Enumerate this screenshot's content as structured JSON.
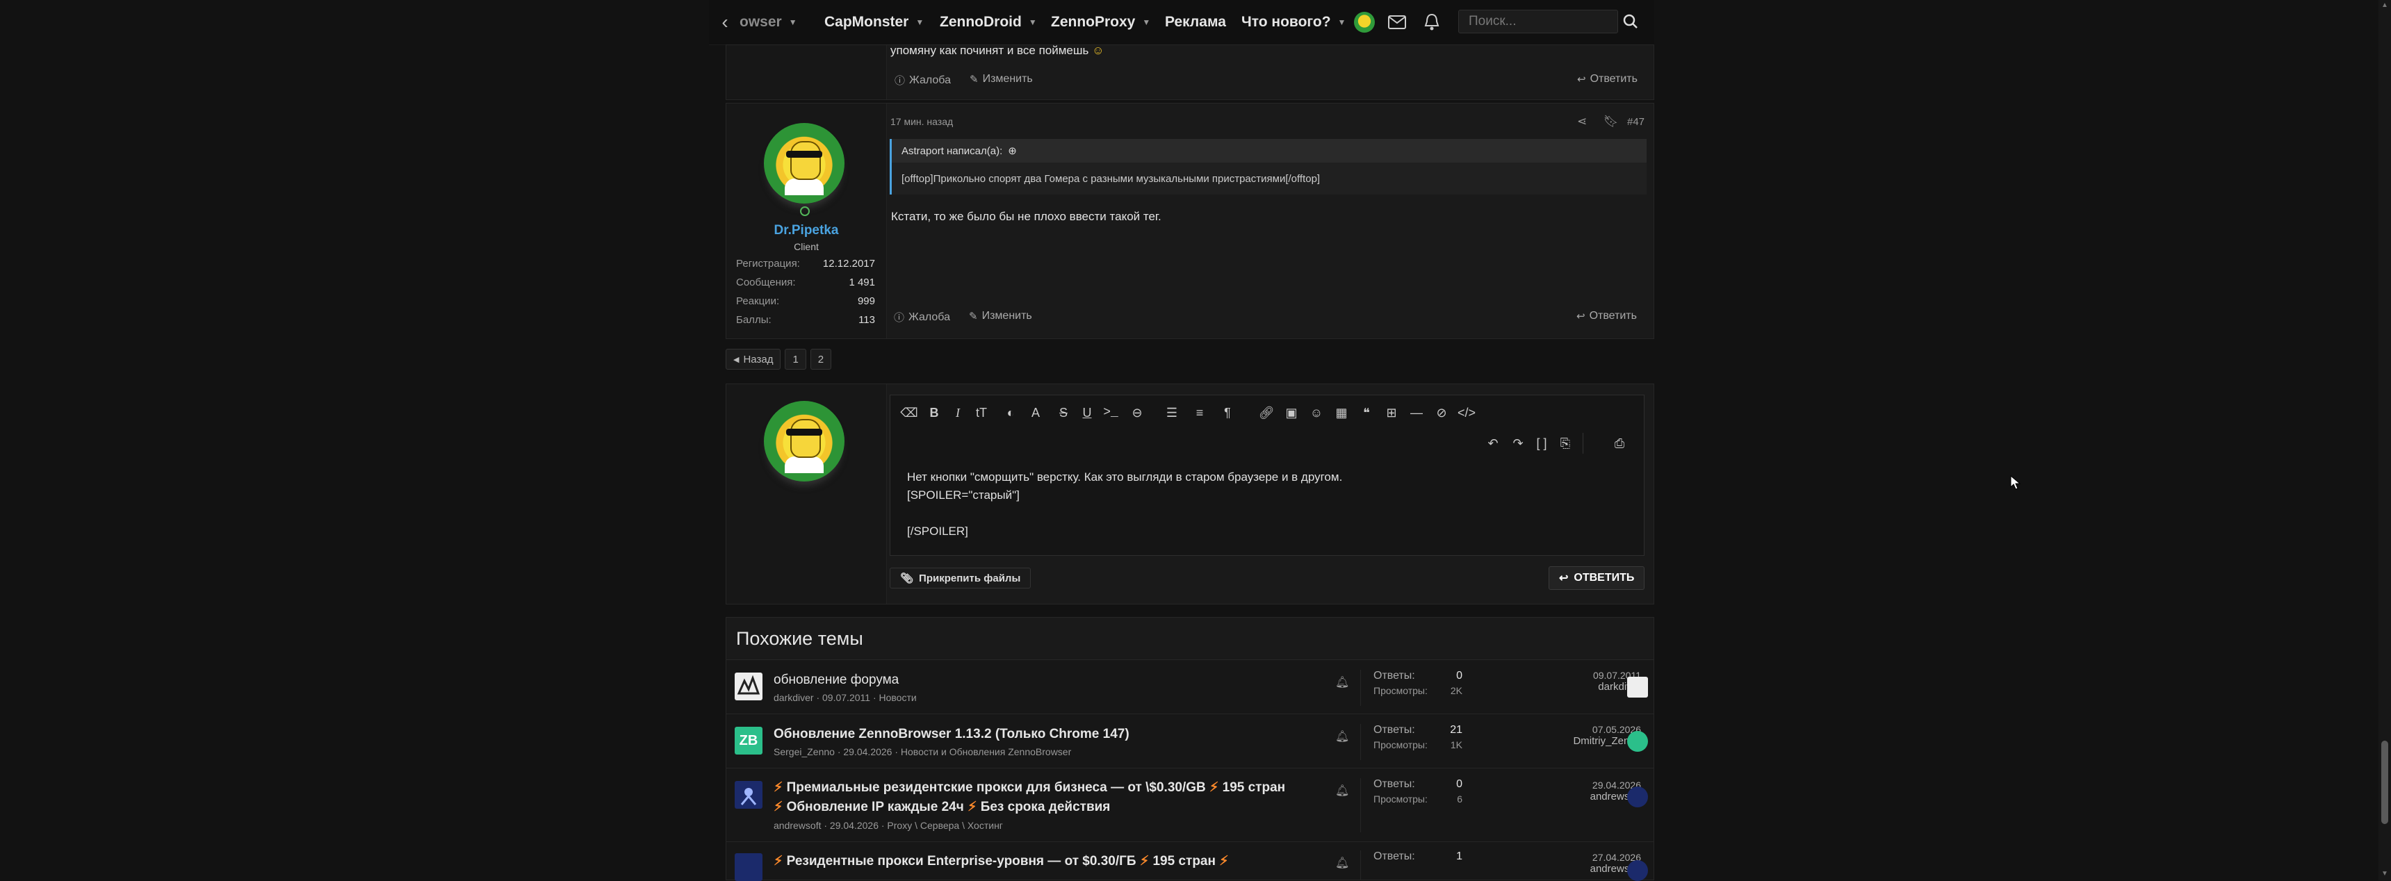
{
  "nav": {
    "items": [
      {
        "label": "owser",
        "caret": true
      },
      {
        "label": "CapMonster",
        "caret": true
      },
      {
        "label": "ZennoDroid",
        "caret": true
      },
      {
        "label": "ZennoProxy",
        "caret": true
      },
      {
        "label": "Реклама",
        "caret": false
      },
      {
        "label": "Что нового?",
        "caret": true
      }
    ],
    "search_placeholder": "Поиск..."
  },
  "prev_post": {
    "text": "упомяну как починят и все поймешь",
    "report": "Жалоба",
    "edit": "Изменить",
    "reply": "Ответить"
  },
  "post": {
    "time": "17 мин. назад",
    "number": "#47",
    "user": {
      "name": "Dr.Pipetka",
      "title": "Client",
      "stats": [
        {
          "label": "Регистрация:",
          "value": "12.12.2017"
        },
        {
          "label": "Сообщения:",
          "value": "1 491"
        },
        {
          "label": "Реакции:",
          "value": "999"
        },
        {
          "label": "Баллы:",
          "value": "113"
        }
      ]
    },
    "quote_author": "Astraport написал(а):",
    "quote_text": "[offtop]Прикольно спорят два Гомера с разными музыкальными пристрастиями[/offtop]",
    "body": "Кстати, то же было бы не плохо ввести такой тег.",
    "report": "Жалоба",
    "edit": "Изменить",
    "reply": "Ответить"
  },
  "pager": {
    "back": "Назад",
    "pages": [
      "1",
      "2"
    ]
  },
  "editor": {
    "lines": [
      "Нет кнопки \"сморщить\" верстку. Как это выгляди в старом браузере и в другом.",
      "[SPOILER=\"старый\"]",
      "",
      "[/SPOILER]"
    ],
    "attach": "Прикрепить файлы",
    "submit": "Ответить"
  },
  "similar": {
    "heading": "Похожие темы",
    "rows": [
      {
        "title": "обновление форума",
        "meta": "darkdiver · 09.07.2011 · Новости",
        "replies_label": "Ответы:",
        "replies": "0",
        "views_label": "Просмотры:",
        "views": "2K",
        "date": "09.07.2011",
        "user": "darkdiver",
        "bold": false
      },
      {
        "title": "Обновление ZennoBrowser 1.13.2 (Только Chrome 147)",
        "meta": "Sergei_Zenno · 29.04.2026 · Новости и Обновления ZennoBrowser",
        "replies_label": "Ответы:",
        "replies": "21",
        "views_label": "Просмотры:",
        "views": "1K",
        "date": "07.05.2026",
        "user": "Dmitriy_Zenno",
        "bold": true
      },
      {
        "title": "Премиальные резидентские прокси для бизнеса — от \\$0.30/GB",
        "title_b": "195 стран",
        "title2": "Обновление IP каждые 24ч",
        "title2_b": "Без срока действия",
        "meta": "andrewsoft · 29.04.2026 · Proxy \\ Сервера \\ Хостинг",
        "replies_label": "Ответы:",
        "replies": "0",
        "views_label": "Просмотры:",
        "views": "6",
        "date": "29.04.2026",
        "user": "andrewsoft",
        "bold": true
      },
      {
        "title": "Резидентные прокси Enterprise-уровня — от $0.30/ГБ",
        "title_b": "195 стран",
        "replies_label": "Ответы:",
        "replies": "1",
        "date": "27.04.2026",
        "user": "andrewsoft",
        "bold": true
      }
    ]
  },
  "colors": {
    "accent": "#4aa3e0",
    "bg": "#121212",
    "panel": "#1a1a1a",
    "lightning": "#ff8a2b"
  }
}
